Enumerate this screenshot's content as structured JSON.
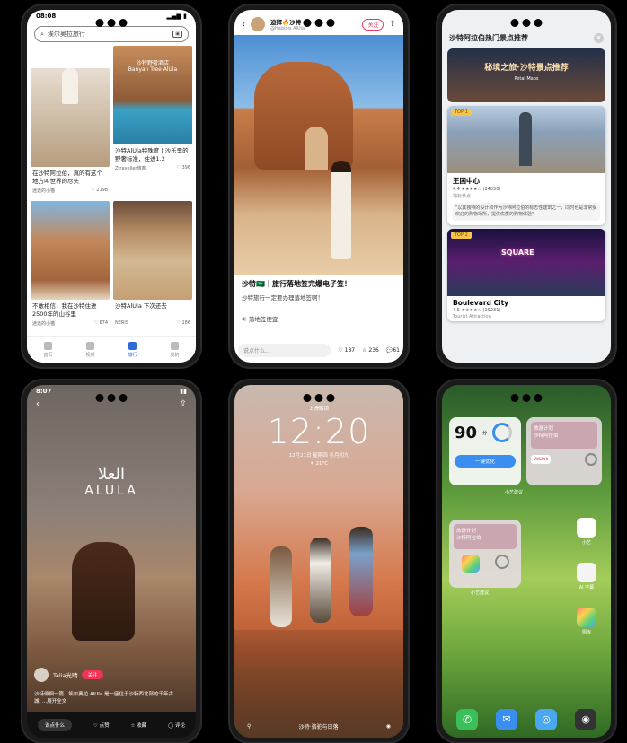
{
  "phone1": {
    "time": "08:08",
    "search_placeholder": "埃尔奥拉旅行",
    "cards": [
      {
        "title": "在沙特阿拉伯，真的有这个地方叫世界的尽头",
        "author": "迷途的小猫",
        "likes": "2198"
      },
      {
        "title": "沙特AlUla特殊度 | 沙乐里的野奢标准，住进1.2",
        "author": "Ztraveller旅客",
        "likes": "396"
      },
      {
        "title": "不敢相信，我在沙特住进2500年的山谷里",
        "author": "迷途的小猫",
        "likes": "674"
      },
      {
        "title": "沙特AlUla 下次还去",
        "author": "NERIS",
        "likes": "186"
      }
    ],
    "card_overlay": "沙特野奢酒店\nBanyan Tree AlUla",
    "tabs": [
      "首页",
      "视频",
      "旅行",
      "我的"
    ],
    "active_tab": 2
  },
  "phone2": {
    "author": "迪拜🔥沙特",
    "author_handle": "@Habibis AlUla",
    "follow": "关注",
    "title": "沙特🇸🇦｜旅行落地签完爆电子签！",
    "subtitle": "沙特旅行一定要办理落地签啊！",
    "tag": "① 落地签便宜",
    "comment_placeholder": "说点什么...",
    "likes": "187",
    "stars": "236",
    "comments": "61"
  },
  "phone3": {
    "header": "沙特阿拉伯热门景点推荐",
    "banner": "秘境之旅·沙特景点推荐",
    "banner_sub": "Petal Maps",
    "pois": [
      {
        "badge": "TOP 1",
        "name": "王国中心",
        "rating": "4.4 ★★★★☆ (24030)",
        "category": "地标景点",
        "quote": "\"以其独特的设计和作为沙特阿拉伯的标志性建筑之一，同时也是非常受欢迎的购物场所，提供优质的购物体验\""
      },
      {
        "badge": "TOP 2",
        "name": "Boulevard City",
        "rating": "4.5 ★★★★☆ (19231)",
        "category": "Tourist Attraction",
        "quote": ""
      }
    ]
  },
  "phone4": {
    "time": "8:07",
    "logo_ar": "العلا",
    "logo_en": "ALULA",
    "author": "Talia光晴",
    "follow": "关注",
    "caption": "沙特徘徊一篇 · 埃尔奥拉 AlUla 是一座位于沙特西北部的千年古城, ...展开全文",
    "input_label": "说点什么",
    "actions": [
      "点赞",
      "收藏",
      "评论"
    ]
  },
  "phone5": {
    "lock_label": "上滑解锁",
    "time": "12:20",
    "date": "12月21日 星期四 冬月初九",
    "weather": "☀ 21°C",
    "footer": "沙特·骆驼与日落"
  },
  "phone6": {
    "battery_score": "90",
    "battery_unit": "分",
    "optimize": "一键优化",
    "travel_widget": "旅游计划",
    "travel_sub": "沙特阿拉伯",
    "suggest": "小艺建议",
    "voelink": "VeLink",
    "apps": [
      "小艺",
      "AI 字幕",
      "图库"
    ],
    "dock": [
      "电话",
      "信息",
      "浏览器",
      "相机"
    ]
  }
}
